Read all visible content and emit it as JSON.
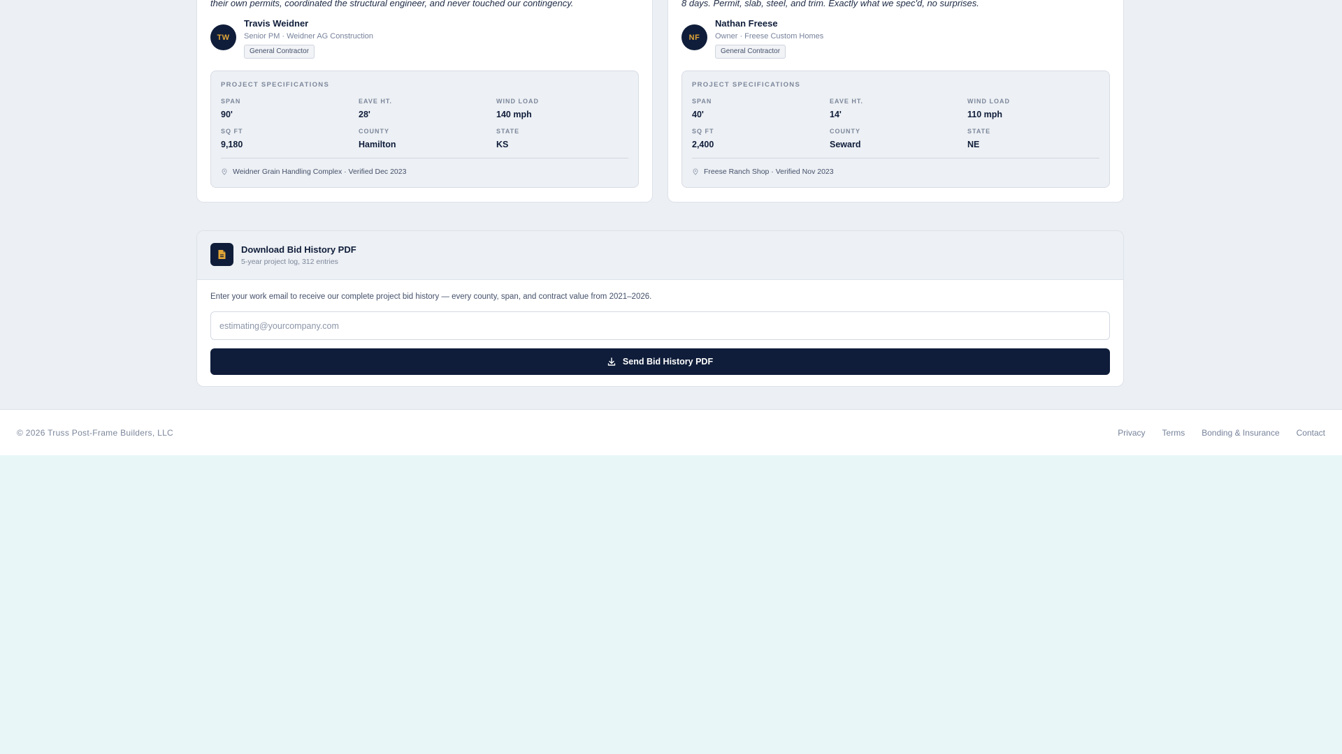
{
  "testimonials": [
    {
      "quote": "their own permits, coordinated the structural engineer, and never touched our contingency.",
      "initials": "TW",
      "name": "Travis Weidner",
      "role": "Senior PM · Weidner AG Construction",
      "tag": "General Contractor",
      "specs_title": "PROJECT SPECIFICATIONS",
      "specs": [
        {
          "label": "SPAN",
          "value": "90'"
        },
        {
          "label": "EAVE HT.",
          "value": "28'"
        },
        {
          "label": "WIND LOAD",
          "value": "140 mph"
        },
        {
          "label": "SQ FT",
          "value": "9,180"
        },
        {
          "label": "COUNTY",
          "value": "Hamilton"
        },
        {
          "label": "STATE",
          "value": "KS"
        }
      ],
      "verified": "Weidner Grain Handling Complex · Verified Dec 2023"
    },
    {
      "quote": "8 days. Permit, slab, steel, and trim. Exactly what we spec'd, no surprises.",
      "initials": "NF",
      "name": "Nathan Freese",
      "role": "Owner · Freese Custom Homes",
      "tag": "General Contractor",
      "specs_title": "PROJECT SPECIFICATIONS",
      "specs": [
        {
          "label": "SPAN",
          "value": "40'"
        },
        {
          "label": "EAVE HT.",
          "value": "14'"
        },
        {
          "label": "WIND LOAD",
          "value": "110 mph"
        },
        {
          "label": "SQ FT",
          "value": "2,400"
        },
        {
          "label": "COUNTY",
          "value": "Seward"
        },
        {
          "label": "STATE",
          "value": "NE"
        }
      ],
      "verified": "Freese Ranch Shop · Verified Nov 2023"
    }
  ],
  "download": {
    "title": "Download Bid History PDF",
    "subtitle": "5-year project log, 312 entries",
    "description": "Enter your work email to receive our complete project bid history — every county, span, and contract value from 2021–2026.",
    "email_placeholder": "estimating@yourcompany.com",
    "email_value": "",
    "button_label": "Send Bid History PDF",
    "icon": "file-icon",
    "button_icon": "download-icon",
    "accent": "#e0a537"
  },
  "footer": {
    "copyright": "© 2026 Truss Post-Frame Builders, LLC",
    "links": [
      "Privacy",
      "Terms",
      "Bonding & Insurance",
      "Contact"
    ]
  },
  "colors": {
    "navy": "#0f1d3a",
    "accent": "#e0a537",
    "page_bg": "#eceff3"
  }
}
